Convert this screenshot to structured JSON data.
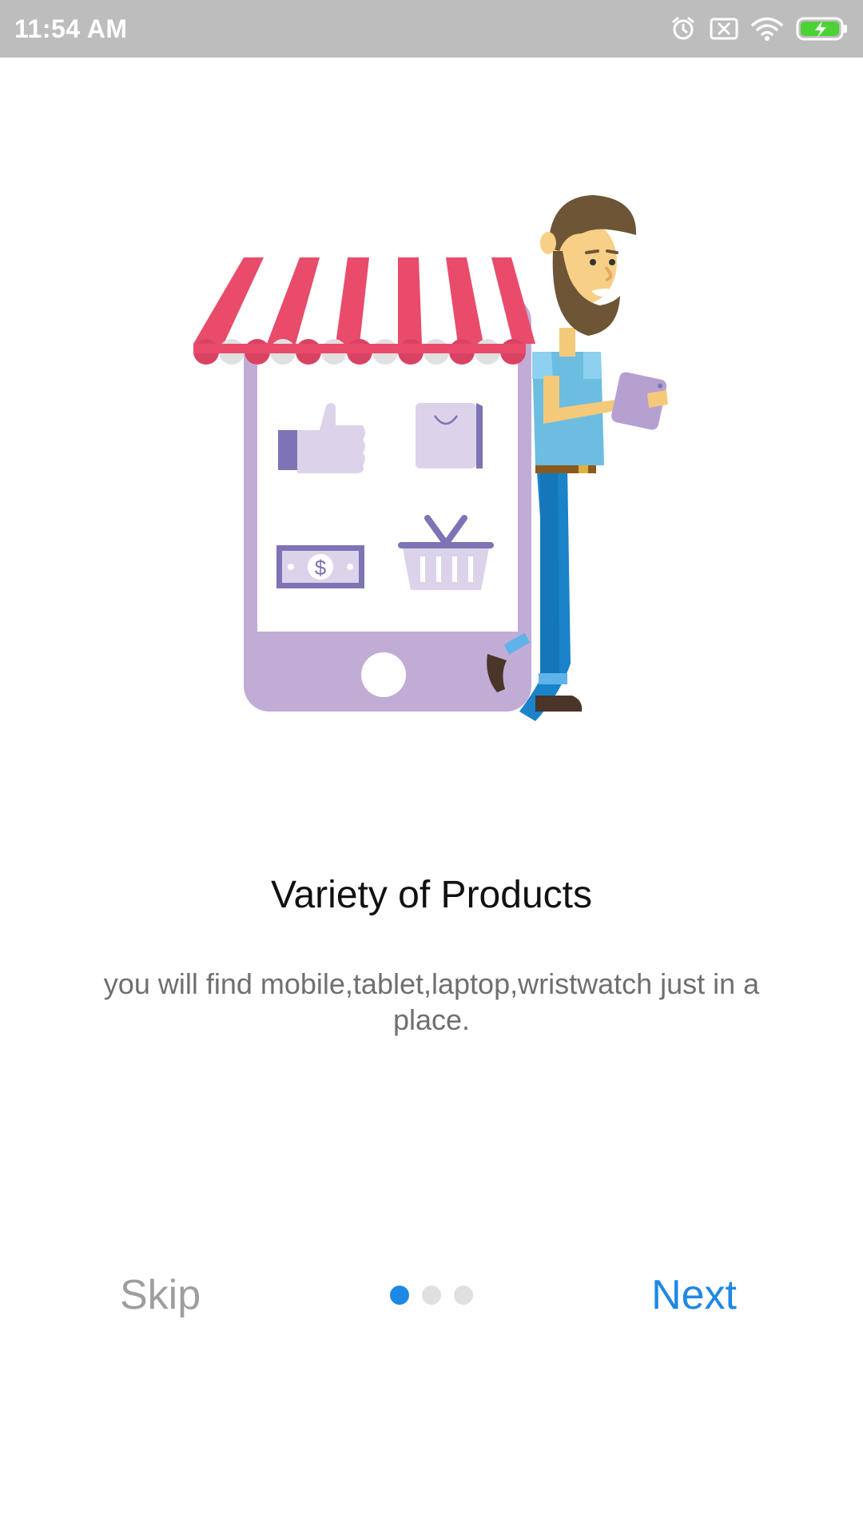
{
  "status_bar": {
    "time": "11:54 AM",
    "icons": [
      "alarm-icon",
      "sim-error-icon",
      "wifi-icon",
      "battery-charging-icon"
    ]
  },
  "onboarding": {
    "title": "Variety of Products",
    "subtitle": "you will find mobile,tablet,laptop,wristwatch just in a place.",
    "illustration": "shop-phone-with-man-illustration"
  },
  "nav": {
    "skip_label": "Skip",
    "next_label": "Next",
    "page_count": 3,
    "active_page": 1
  },
  "colors": {
    "accent": "#1e88e5",
    "awning_red": "#e94b6b",
    "phone_purple": "#c1acd5",
    "status_bar": "#bdbdbd"
  }
}
